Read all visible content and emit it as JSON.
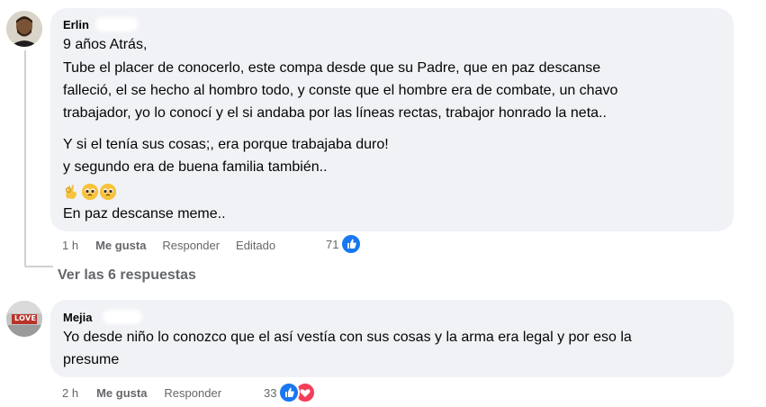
{
  "comments": [
    {
      "author": "Erlin",
      "lines": [
        "9 años Atrás,",
        "Tube el placer de conocerlo, este compa desde que su Padre, que en paz descanse",
        "falleció, el se hecho al hombro todo, y conste que el hombre era de combate, un chavo",
        "trabajador, yo lo conocí y el si andaba por las líneas rectas, trabajor honrado la neta..",
        "Y si el tenía sus cosas;, era porque trabajaba duro!",
        "y segundo era de buena familia también..",
        "En paz descanse meme.."
      ],
      "emoji": [
        "ok-hand-emoji",
        "pleading-face-emoji",
        "pleading-face-emoji"
      ],
      "time": "1 h",
      "like_label": "Me gusta",
      "reply_label": "Responder",
      "edited_label": "Editado",
      "reaction_count": "71",
      "reactions": [
        "like-icon"
      ]
    },
    {
      "author": "Mejia",
      "avatar_text": "LOVE",
      "lines": [
        "Yo desde niño lo conozco que el así vestía con sus cosas y la arma era legal y por eso la",
        "presume"
      ],
      "time": "2 h",
      "like_label": "Me gusta",
      "reply_label": "Responder",
      "reaction_count": "33",
      "reactions": [
        "like-icon",
        "love-icon"
      ]
    }
  ],
  "view_replies": "Ver las 6 respuestas",
  "colors": {
    "like": "#1877f2",
    "love": "#f33e58",
    "bubble": "#f0f2f5",
    "meta": "#65676b"
  }
}
